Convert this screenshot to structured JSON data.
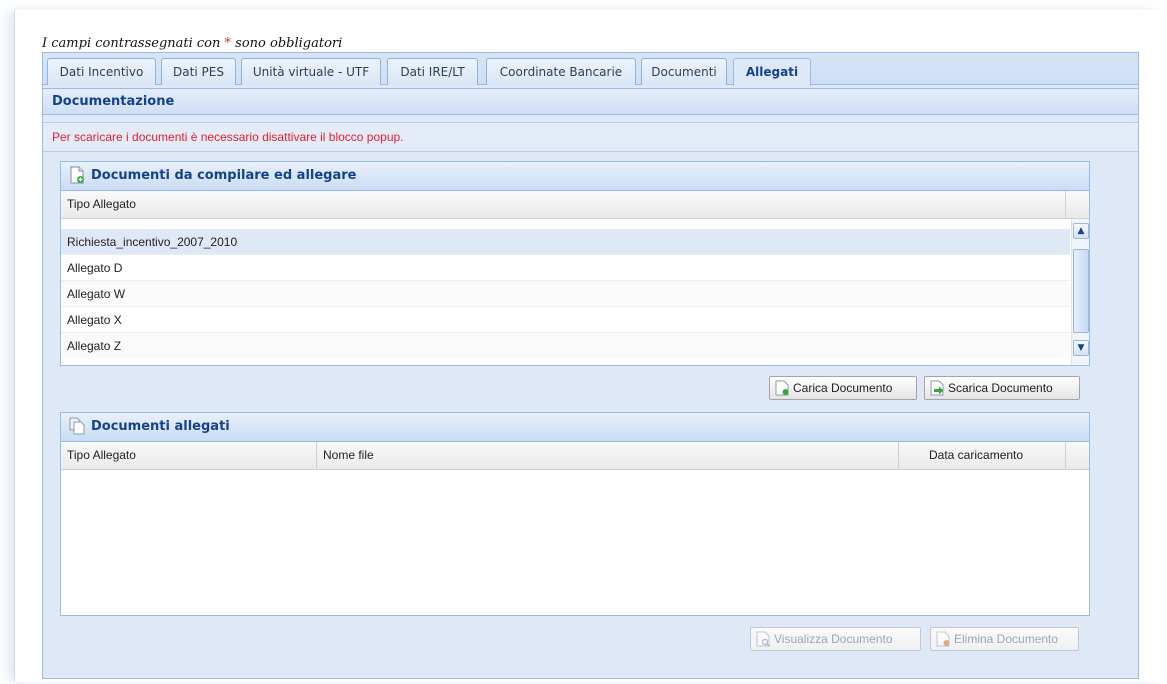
{
  "required_note": {
    "prefix": "I campi contrassegnati con",
    "star": "*",
    "suffix": "sono obbligatori"
  },
  "tabs": [
    {
      "label": "Dati Incentivo",
      "active": false
    },
    {
      "label": "Dati PES",
      "active": false
    },
    {
      "label": "Unità virtuale - UTF",
      "active": false
    },
    {
      "label": "Dati IRE/LT",
      "active": false
    },
    {
      "label": "Coordinate Bancarie",
      "active": false
    },
    {
      "label": "Documenti",
      "active": false
    },
    {
      "label": "Allegati",
      "active": true
    }
  ],
  "section": {
    "title": "Documentazione",
    "warning": "Per scaricare i documenti è necessario disattivare il blocco popup."
  },
  "to_fill": {
    "title": "Documenti da compilare ed allegare",
    "columns": [
      "Tipo Allegato"
    ],
    "rows": [
      "Richiesta_incentivo_2007_2010",
      "Allegato D",
      "Allegato W",
      "Allegato X",
      "Allegato Z"
    ],
    "buttons": {
      "upload": "Carica Documento",
      "download": "Scarica Documento"
    }
  },
  "attached": {
    "title": "Documenti allegati",
    "columns": [
      "Tipo Allegato",
      "Nome file",
      "Data caricamento"
    ],
    "buttons": {
      "view": "Visualizza Documento",
      "delete": "Elimina Documento"
    }
  },
  "colors": {
    "accent": "#15428b",
    "warning": "#e0202d",
    "panel_bg": "#dfe8f6"
  }
}
